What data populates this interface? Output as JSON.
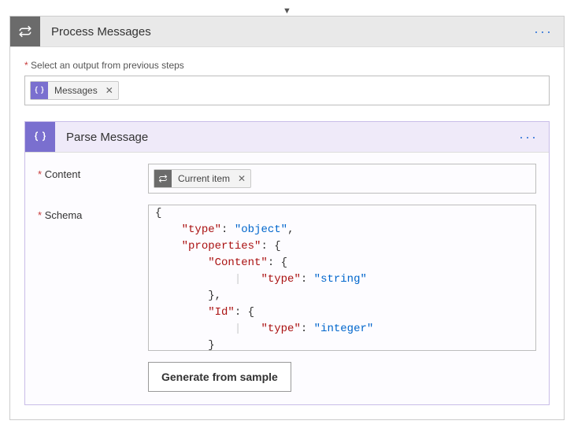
{
  "outerCard": {
    "title": "Process Messages",
    "selectLabel": "Select an output from previous steps",
    "token": {
      "label": "Messages"
    }
  },
  "innerCard": {
    "title": "Parse Message",
    "contentLabel": "Content",
    "contentToken": {
      "label": "Current item"
    },
    "schemaLabel": "Schema",
    "schema": {
      "lines": [
        {
          "indent": 0,
          "type": "brace",
          "text": "{"
        },
        {
          "indent": 1,
          "type": "kv",
          "key": "type",
          "value": "object",
          "comma": true
        },
        {
          "indent": 1,
          "type": "keyopen",
          "key": "properties"
        },
        {
          "indent": 2,
          "type": "keyopen",
          "key": "Content"
        },
        {
          "indent": 3,
          "type": "kv",
          "key": "type",
          "value": "string",
          "guide": true
        },
        {
          "indent": 2,
          "type": "close",
          "comma": true
        },
        {
          "indent": 2,
          "type": "keyopen",
          "key": "Id"
        },
        {
          "indent": 3,
          "type": "kv",
          "key": "type",
          "value": "integer",
          "guide": true
        },
        {
          "indent": 2,
          "type": "close"
        },
        {
          "indent": 1,
          "type": "close"
        }
      ]
    },
    "generateBtn": "Generate from sample"
  }
}
